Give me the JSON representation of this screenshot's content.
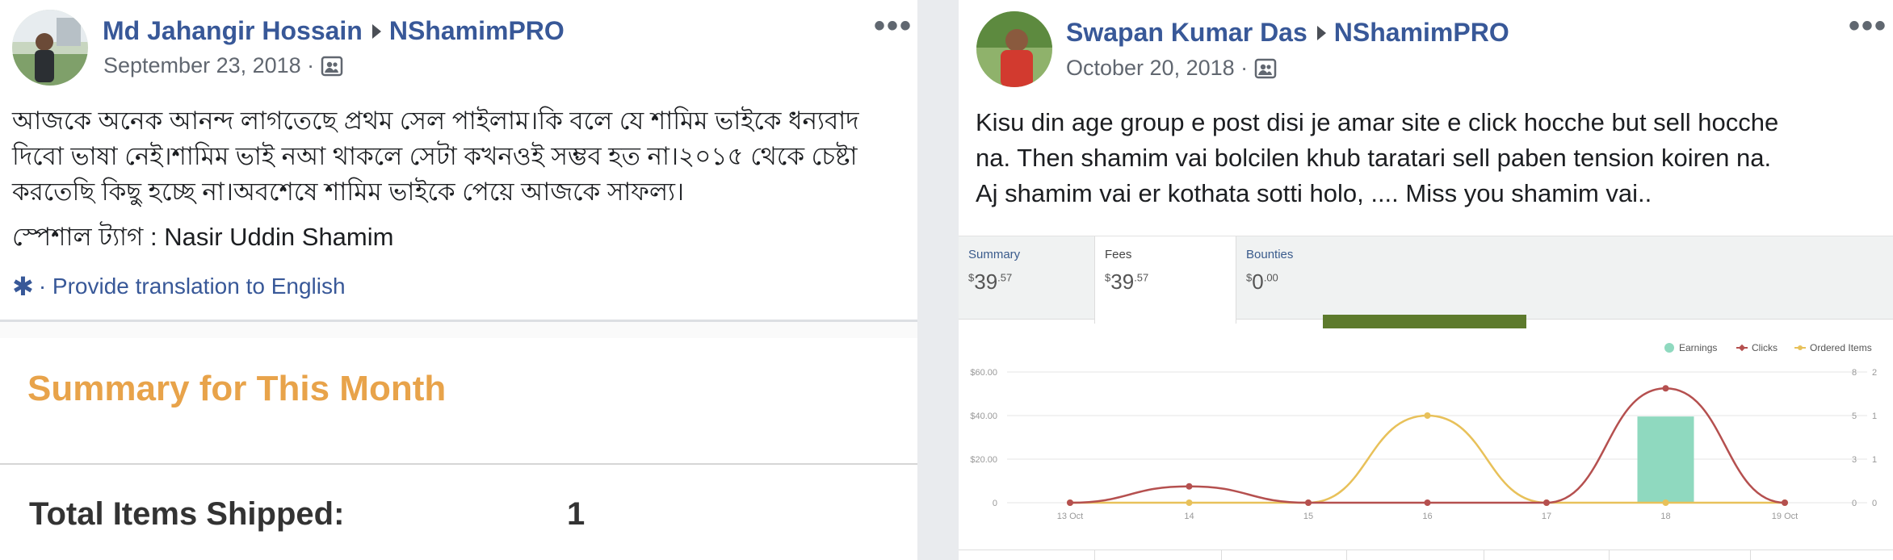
{
  "left_post": {
    "author": "Md Jahangir Hossain",
    "group": "NShamimPRO",
    "date": "September 23, 2018 ·",
    "more": "•••",
    "paragraph_lines": [
      "আজকে অনেক আনন্দ লাগতেছে প্রথম সেল পাইলাম।কি বলে যে শামিম ভাইকে ধন্যবাদ",
      "দিবো ভাষা নেই।শামিম ভাই নআ থাকলে সেটা কখনওই সম্ভব হত না।২০১৫ থেকে চেষ্টা",
      "করতেছি কিছু হচ্ছে না।অবশেষে শামিম ভাইকে পেয়ে আজকে সাফল্য।"
    ],
    "special_tag": "স্পেশাল ট্যাগ : Nasir Uddin Shamim",
    "translate_link": "· Provide translation to English",
    "shared_image": {
      "title": "Summary for This Month",
      "shipped_label": "Total Items Shipped:",
      "shipped_value": "1"
    }
  },
  "right_post": {
    "author": "Swapan Kumar Das",
    "group": "NShamimPRO",
    "date": "October 20, 2018 ·",
    "more": "•••",
    "paragraph_lines": [
      "Kisu din age group e post disi je amar site e click hocche but sell hocche",
      "na. Then shamim vai bolcilen khub taratari sell paben tension koiren na.",
      "Aj shamim vai er kothata sotti holo, .... Miss you shamim vai.."
    ],
    "tabs": [
      {
        "label": "Summary",
        "currency": "$",
        "main": "39",
        "cents": ".57"
      },
      {
        "label": "Fees",
        "currency": "$",
        "main": "39",
        "cents": ".57"
      },
      {
        "label": "Bounties",
        "currency": "$",
        "main": "0",
        "cents": ".00"
      }
    ]
  },
  "colors": {
    "link": "#385898",
    "earnings": "#8fd9bf",
    "clicks": "#b5504f",
    "ordered_items": "#e8c15a",
    "summary_title": "#e8a34a"
  },
  "chart_data": {
    "type": "line",
    "categories": [
      "13 Oct",
      "14",
      "15",
      "16",
      "17",
      "18",
      "19 Oct"
    ],
    "series": [
      {
        "name": "Earnings",
        "kind": "bar",
        "axis": "left",
        "values": [
          0,
          0,
          0,
          0,
          0,
          39.57,
          0
        ]
      },
      {
        "name": "Clicks",
        "kind": "line",
        "axis": "right1",
        "values": [
          0,
          1,
          0,
          0,
          0,
          7,
          0
        ]
      },
      {
        "name": "Ordered Items",
        "kind": "line",
        "axis": "right2",
        "values": [
          0,
          0,
          0,
          1,
          0,
          0,
          0
        ]
      }
    ],
    "y_left_ticks": [
      "0",
      "$20.00",
      "$40.00",
      "$60.00"
    ],
    "y_right1_ticks": [
      "0",
      "3",
      "5",
      "8"
    ],
    "y_right2_ticks": [
      "0",
      "1",
      "1",
      "2"
    ],
    "ylim_left": [
      0,
      60
    ],
    "ylim_right1": [
      0,
      8
    ],
    "ylim_right2": [
      0,
      1.5
    ],
    "legend": [
      "Earnings",
      "Clicks",
      "Ordered Items"
    ],
    "legend_position": "top-right",
    "grid": true
  }
}
